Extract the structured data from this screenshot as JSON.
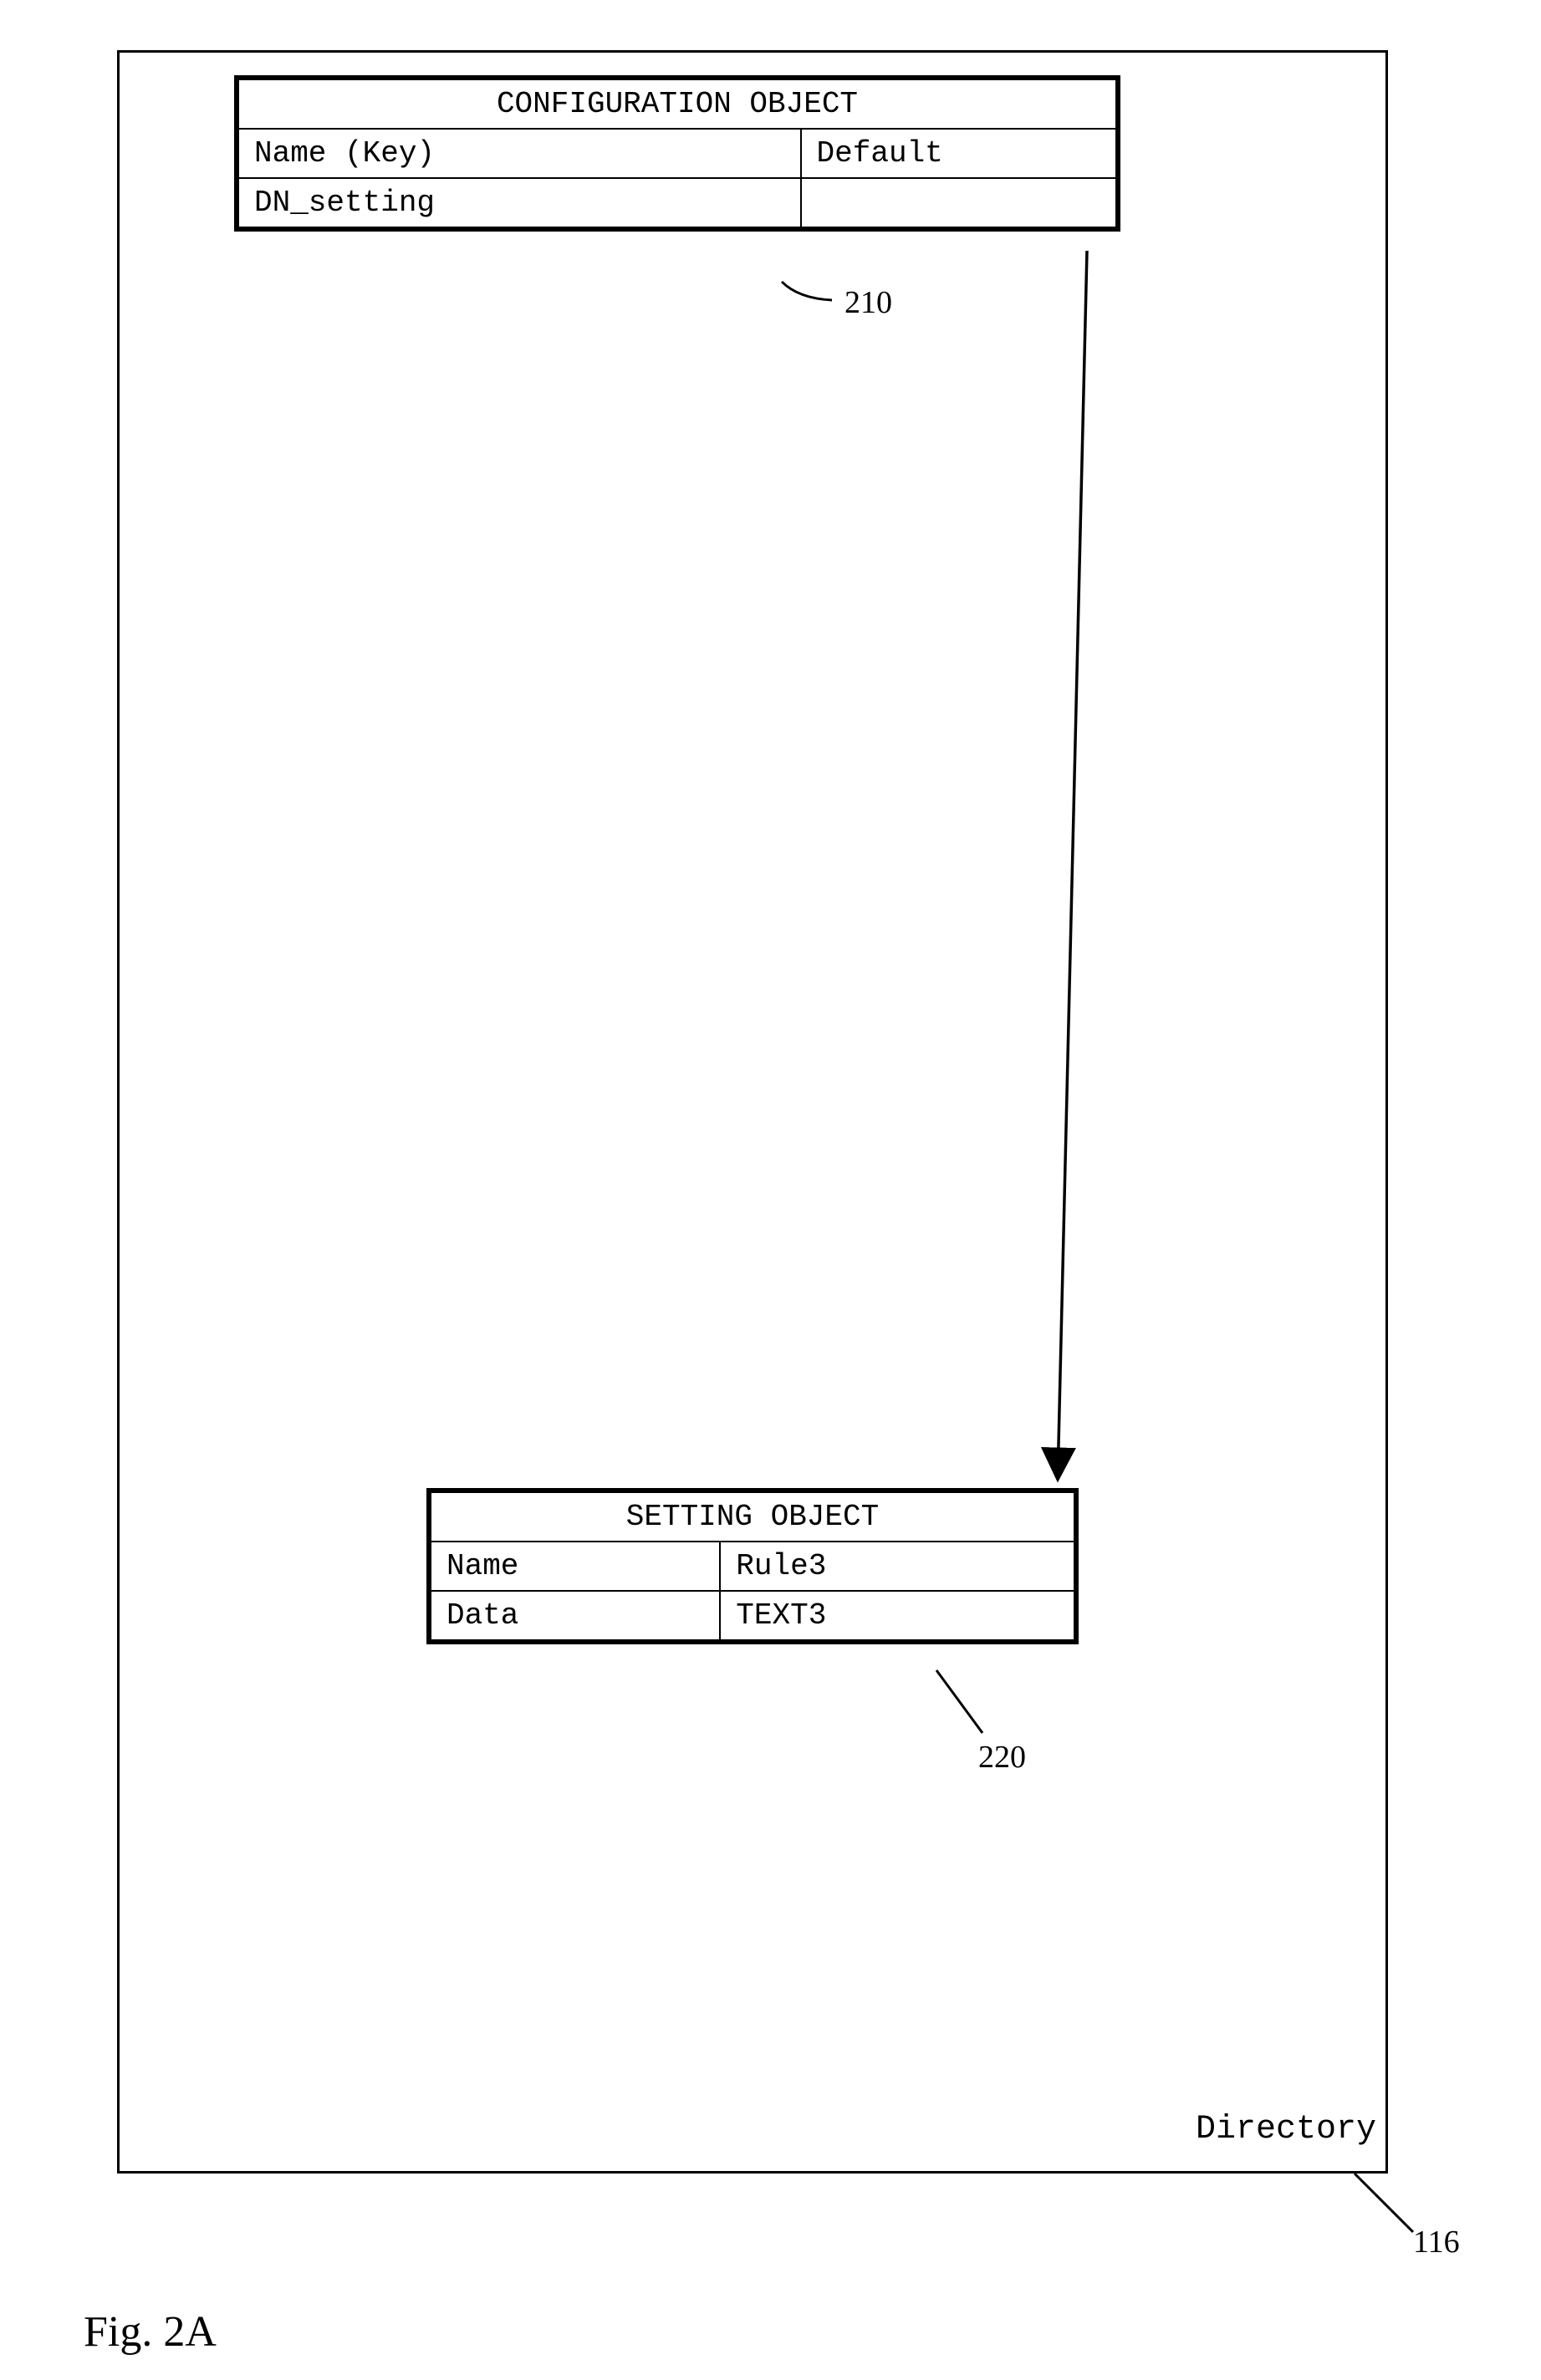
{
  "directory": {
    "label": "Directory",
    "ref": "116"
  },
  "config_object": {
    "title": "CONFIGURATION OBJECT",
    "header_name": "Name (Key)",
    "header_default": "Default",
    "row_name": "DN_setting",
    "row_default": "",
    "ref": "210"
  },
  "setting_object": {
    "title": "SETTING OBJECT",
    "row1_key": "Name",
    "row1_val": "Rule3",
    "row2_key": "Data",
    "row2_val": "TEXT3",
    "ref": "220"
  },
  "figure_caption": "Fig. 2A"
}
